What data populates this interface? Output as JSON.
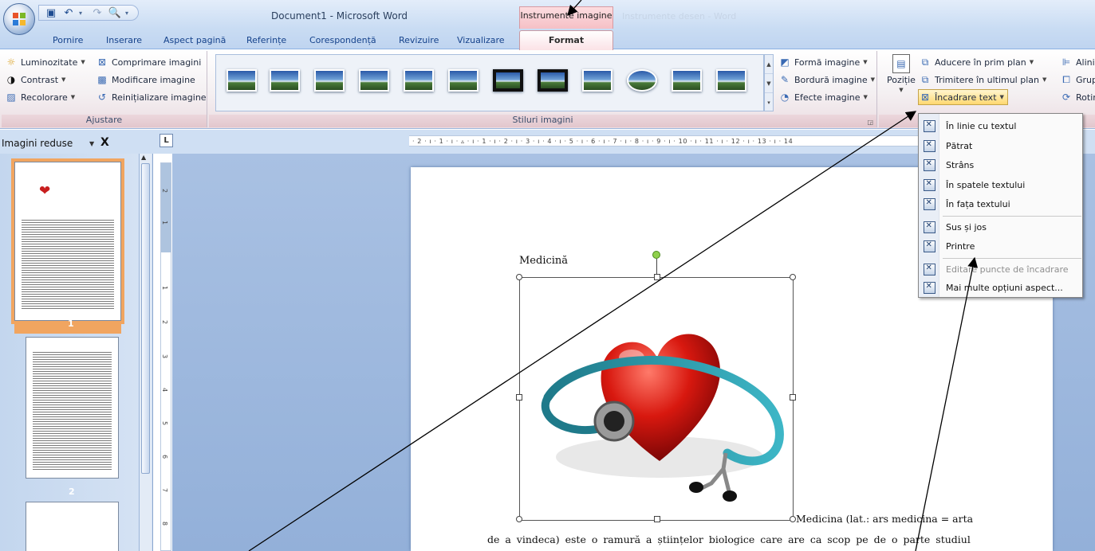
{
  "window": {
    "title": "Document1 - Microsoft Word",
    "context_tab_group": "Instrumente imagine",
    "faded_title": "Instrumente desen - Word"
  },
  "quick_access": {
    "save_icon": "save-icon",
    "undo_icon": "undo-icon",
    "redo_icon": "redo-icon",
    "preview_icon": "print-preview-icon"
  },
  "tabs": [
    "Pornire",
    "Inserare",
    "Aspect pagină",
    "Referințe",
    "Corespondență",
    "Revizuire",
    "Vizualizare",
    "Format"
  ],
  "ribbon": {
    "adjust": {
      "label": "Ajustare",
      "brightness": "Luminozitate",
      "contrast": "Contrast",
      "recolor": "Recolorare",
      "compress": "Comprimare imagini",
      "change": "Modificare imagine",
      "reset": "Reinițializare imagine"
    },
    "picture_styles": {
      "label": "Stiluri imagini",
      "shape": "Formă imagine",
      "border": "Bordură imagine",
      "effects": "Efecte imagine"
    },
    "arrange": {
      "position": "Poziție",
      "bring_front": "Aducere în prim plan",
      "send_back": "Trimitere în ultimul plan",
      "text_wrap": "Încadrare text",
      "align": "Aliniere",
      "group": "Grupare",
      "rotate": "Rotire"
    }
  },
  "thumbnails": {
    "title": "Imagini reduse",
    "close": "X",
    "pages": [
      "1",
      "2"
    ]
  },
  "ruler": {
    "corner": "L",
    "horizontal": "· 2 · ı · 1 · ı · ▵ · ı · 1 · ı · 2 · ı · 3 · ı · 4 · ı · 5 · ı · 6 · ı · 7 · ı · 8 · ı · 9 · ı · 10 · ı · 11 · ı · 12 · ı · 13 · ı · 14",
    "vertical": [
      "2",
      "1",
      "1",
      "2",
      "3",
      "4",
      "5",
      "6",
      "7",
      "8"
    ]
  },
  "document": {
    "heading": "Medicină",
    "line1": "Medicina (lat.: ars medicina = arta",
    "line2": "de a vindeca) este o ramură a științelor biologice care are ca scop pe de o parte studiul"
  },
  "wrap_menu": {
    "items": [
      "În linie cu textul",
      "Pătrat",
      "Strâns",
      "În spatele textului",
      "În fața textului",
      "Sus și jos",
      "Printre",
      "Editare puncte de încadrare",
      "Mai multe opțiuni aspect..."
    ]
  }
}
